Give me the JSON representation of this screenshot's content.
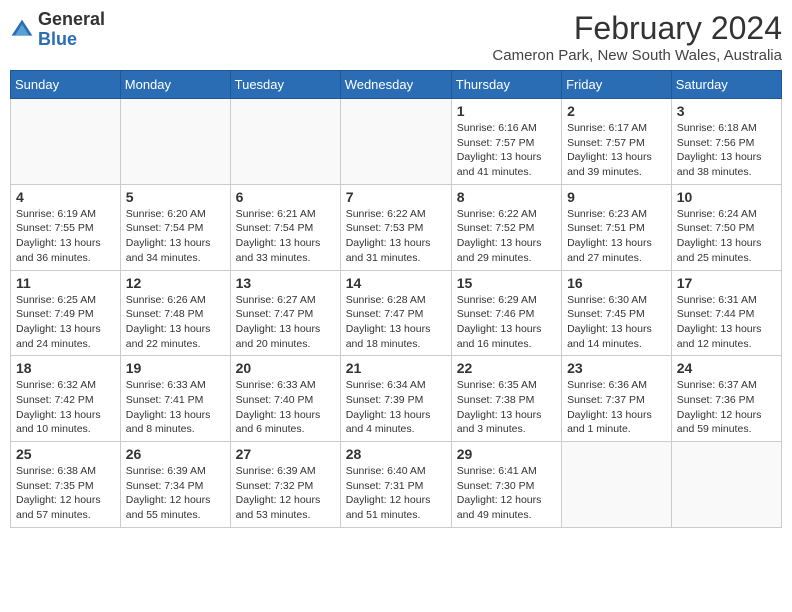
{
  "header": {
    "logo_general": "General",
    "logo_blue": "Blue",
    "month_title": "February 2024",
    "location": "Cameron Park, New South Wales, Australia"
  },
  "days_of_week": [
    "Sunday",
    "Monday",
    "Tuesday",
    "Wednesday",
    "Thursday",
    "Friday",
    "Saturday"
  ],
  "weeks": [
    [
      {
        "day": "",
        "info": ""
      },
      {
        "day": "",
        "info": ""
      },
      {
        "day": "",
        "info": ""
      },
      {
        "day": "",
        "info": ""
      },
      {
        "day": "1",
        "info": "Sunrise: 6:16 AM\nSunset: 7:57 PM\nDaylight: 13 hours and 41 minutes."
      },
      {
        "day": "2",
        "info": "Sunrise: 6:17 AM\nSunset: 7:57 PM\nDaylight: 13 hours and 39 minutes."
      },
      {
        "day": "3",
        "info": "Sunrise: 6:18 AM\nSunset: 7:56 PM\nDaylight: 13 hours and 38 minutes."
      }
    ],
    [
      {
        "day": "4",
        "info": "Sunrise: 6:19 AM\nSunset: 7:55 PM\nDaylight: 13 hours and 36 minutes."
      },
      {
        "day": "5",
        "info": "Sunrise: 6:20 AM\nSunset: 7:54 PM\nDaylight: 13 hours and 34 minutes."
      },
      {
        "day": "6",
        "info": "Sunrise: 6:21 AM\nSunset: 7:54 PM\nDaylight: 13 hours and 33 minutes."
      },
      {
        "day": "7",
        "info": "Sunrise: 6:22 AM\nSunset: 7:53 PM\nDaylight: 13 hours and 31 minutes."
      },
      {
        "day": "8",
        "info": "Sunrise: 6:22 AM\nSunset: 7:52 PM\nDaylight: 13 hours and 29 minutes."
      },
      {
        "day": "9",
        "info": "Sunrise: 6:23 AM\nSunset: 7:51 PM\nDaylight: 13 hours and 27 minutes."
      },
      {
        "day": "10",
        "info": "Sunrise: 6:24 AM\nSunset: 7:50 PM\nDaylight: 13 hours and 25 minutes."
      }
    ],
    [
      {
        "day": "11",
        "info": "Sunrise: 6:25 AM\nSunset: 7:49 PM\nDaylight: 13 hours and 24 minutes."
      },
      {
        "day": "12",
        "info": "Sunrise: 6:26 AM\nSunset: 7:48 PM\nDaylight: 13 hours and 22 minutes."
      },
      {
        "day": "13",
        "info": "Sunrise: 6:27 AM\nSunset: 7:47 PM\nDaylight: 13 hours and 20 minutes."
      },
      {
        "day": "14",
        "info": "Sunrise: 6:28 AM\nSunset: 7:47 PM\nDaylight: 13 hours and 18 minutes."
      },
      {
        "day": "15",
        "info": "Sunrise: 6:29 AM\nSunset: 7:46 PM\nDaylight: 13 hours and 16 minutes."
      },
      {
        "day": "16",
        "info": "Sunrise: 6:30 AM\nSunset: 7:45 PM\nDaylight: 13 hours and 14 minutes."
      },
      {
        "day": "17",
        "info": "Sunrise: 6:31 AM\nSunset: 7:44 PM\nDaylight: 13 hours and 12 minutes."
      }
    ],
    [
      {
        "day": "18",
        "info": "Sunrise: 6:32 AM\nSunset: 7:42 PM\nDaylight: 13 hours and 10 minutes."
      },
      {
        "day": "19",
        "info": "Sunrise: 6:33 AM\nSunset: 7:41 PM\nDaylight: 13 hours and 8 minutes."
      },
      {
        "day": "20",
        "info": "Sunrise: 6:33 AM\nSunset: 7:40 PM\nDaylight: 13 hours and 6 minutes."
      },
      {
        "day": "21",
        "info": "Sunrise: 6:34 AM\nSunset: 7:39 PM\nDaylight: 13 hours and 4 minutes."
      },
      {
        "day": "22",
        "info": "Sunrise: 6:35 AM\nSunset: 7:38 PM\nDaylight: 13 hours and 3 minutes."
      },
      {
        "day": "23",
        "info": "Sunrise: 6:36 AM\nSunset: 7:37 PM\nDaylight: 13 hours and 1 minute."
      },
      {
        "day": "24",
        "info": "Sunrise: 6:37 AM\nSunset: 7:36 PM\nDaylight: 12 hours and 59 minutes."
      }
    ],
    [
      {
        "day": "25",
        "info": "Sunrise: 6:38 AM\nSunset: 7:35 PM\nDaylight: 12 hours and 57 minutes."
      },
      {
        "day": "26",
        "info": "Sunrise: 6:39 AM\nSunset: 7:34 PM\nDaylight: 12 hours and 55 minutes."
      },
      {
        "day": "27",
        "info": "Sunrise: 6:39 AM\nSunset: 7:32 PM\nDaylight: 12 hours and 53 minutes."
      },
      {
        "day": "28",
        "info": "Sunrise: 6:40 AM\nSunset: 7:31 PM\nDaylight: 12 hours and 51 minutes."
      },
      {
        "day": "29",
        "info": "Sunrise: 6:41 AM\nSunset: 7:30 PM\nDaylight: 12 hours and 49 minutes."
      },
      {
        "day": "",
        "info": ""
      },
      {
        "day": "",
        "info": ""
      }
    ]
  ]
}
